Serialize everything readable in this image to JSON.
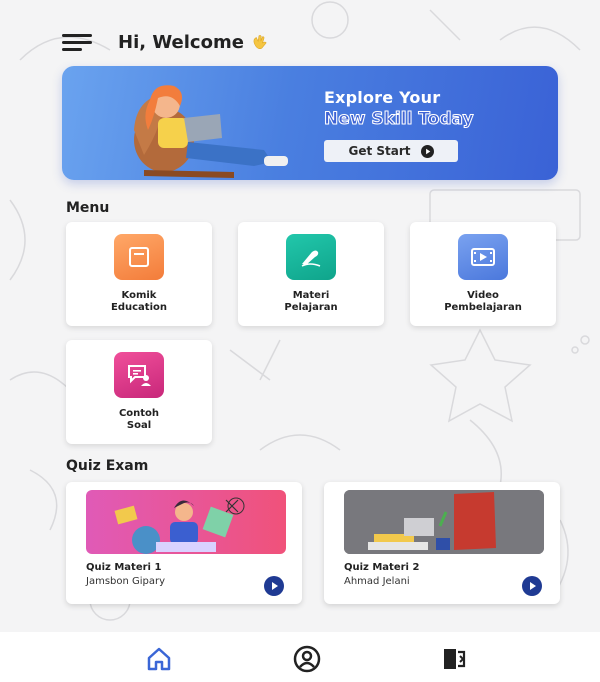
{
  "header": {
    "greeting": "Hi, Welcome"
  },
  "banner": {
    "line1": "Explore Your",
    "line2": "New Skill Today",
    "button_label": "Get Start"
  },
  "menu": {
    "title": "Menu",
    "items": [
      {
        "label": "Komik\nEducation",
        "icon": "book-icon",
        "color": "#f7904a"
      },
      {
        "label": "Materi\nPelajaran",
        "icon": "pen-icon",
        "color": "#17b39a"
      },
      {
        "label": "Video\nPembelajaran",
        "icon": "video-icon",
        "color": "#5b86e5"
      },
      {
        "label": "Contoh\nSoal",
        "icon": "chat-user-icon",
        "color": "#e03b8b"
      }
    ]
  },
  "quiz": {
    "title": "Quiz Exam",
    "items": [
      {
        "title": "Quiz Materi 1",
        "author": "Jamsbon Gipary"
      },
      {
        "title": "Quiz Materi 2",
        "author": "Ahmad Jelani"
      }
    ]
  },
  "colors": {
    "accent": "#4a7fe0",
    "play": "#1f3a93"
  }
}
